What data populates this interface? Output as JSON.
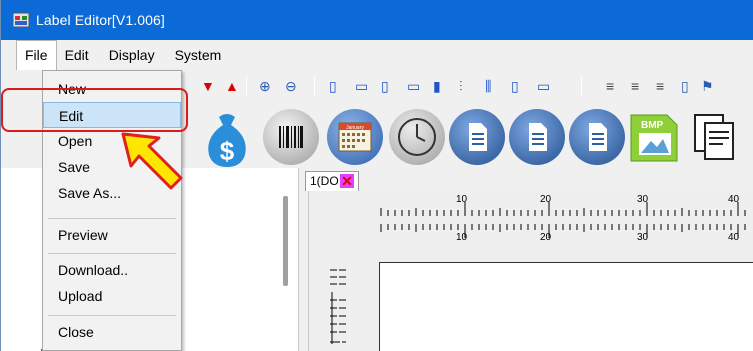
{
  "window": {
    "title": "Label Editor[V1.006]"
  },
  "menubar": {
    "items": [
      "File",
      "Edit",
      "Display",
      "System"
    ]
  },
  "file_menu": {
    "items": [
      "New",
      "Edit",
      "Open",
      "Save",
      "Save As...",
      "Preview",
      "Download..",
      "Upload",
      "Close"
    ],
    "highlighted": "Edit"
  },
  "toolbar": {
    "icons": [
      "arrow-down-red-icon",
      "arrow-up-red-icon",
      "zoom-in-icon",
      "zoom-out-icon",
      "align-left-icon",
      "align-top-icon",
      "align-right-icon",
      "align-bottom-icon",
      "distribute-h-icon",
      "distribute-v-icon",
      "center-h-icon",
      "center-v-icon",
      "same-size-icon",
      "text-align-left-icon",
      "text-align-center-icon",
      "text-align-right-icon",
      "page-icon",
      "flag-icon"
    ]
  },
  "tools_row": {
    "icons": [
      "money-bag-icon",
      "barcode-icon",
      "calendar-icon",
      "clock-icon",
      "document-icon",
      "document-icon",
      "document-icon",
      "bmp-image-icon",
      "copy-icon"
    ],
    "bmp_label": "BMP",
    "calendar_label": "January"
  },
  "document": {
    "tab_label": "1(DO"
  },
  "ruler": {
    "ticks": [
      "10",
      "20",
      "30",
      "40"
    ]
  },
  "colors": {
    "titlebar": "#0c6ad6",
    "highlight_border": "#d81b1b",
    "arrow_fill": "#ffe600"
  }
}
